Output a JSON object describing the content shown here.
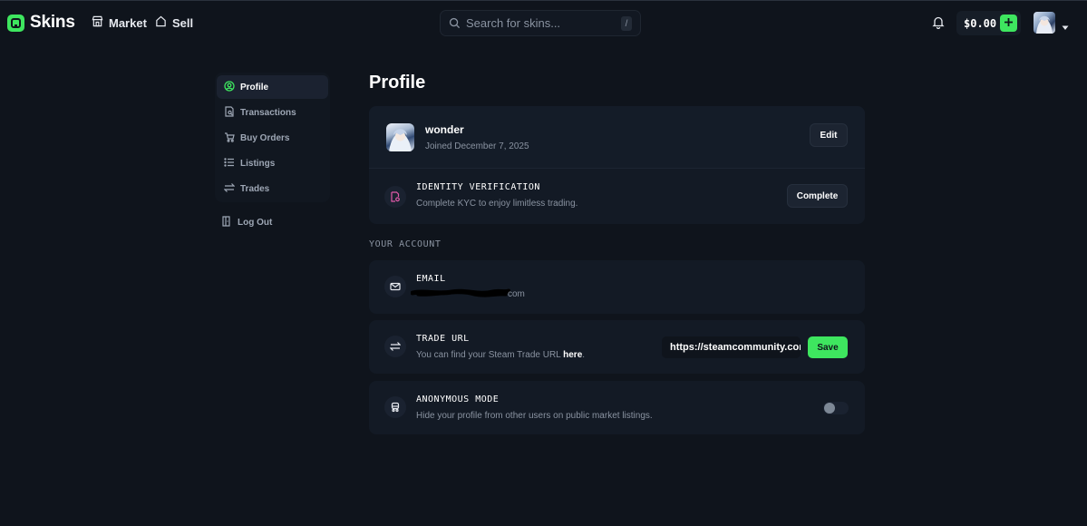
{
  "topbar": {
    "brand": "Skins",
    "nav": [
      {
        "label": "Market",
        "icon": "storefront-icon"
      },
      {
        "label": "Sell",
        "icon": "tag-icon"
      }
    ],
    "search": {
      "placeholder": "Search for skins...",
      "shortcut": "/"
    },
    "balance": "$0.00",
    "colors": {
      "accent": "#3ee65f",
      "background": "#0f141c"
    }
  },
  "sidebar": {
    "items": [
      {
        "label": "Profile",
        "icon": "user-circle-icon",
        "active": true
      },
      {
        "label": "Transactions",
        "icon": "receipt-search-icon",
        "active": false
      },
      {
        "label": "Buy Orders",
        "icon": "cart-icon",
        "active": false
      },
      {
        "label": "Listings",
        "icon": "list-icon",
        "active": false
      },
      {
        "label": "Trades",
        "icon": "arrows-exchange-icon",
        "active": false
      }
    ],
    "logout": {
      "label": "Log Out",
      "icon": "logout-icon"
    }
  },
  "main": {
    "title": "Profile",
    "profile": {
      "username": "wonder",
      "joined": "Joined December 7, 2025",
      "edit_label": "Edit"
    },
    "kyc": {
      "title": "IDENTITY VERIFICATION",
      "description": "Complete KYC to enjoy limitless trading.",
      "button": "Complete"
    },
    "section_label": "YOUR ACCOUNT",
    "email": {
      "title": "EMAIL",
      "value_suffix": "com"
    },
    "trade_url": {
      "title": "TRADE URL",
      "description_prefix": "You can find your Steam Trade URL ",
      "link_text": "here",
      "description_suffix": ".",
      "value": "https://steamcommunity.com",
      "save_label": "Save"
    },
    "anonymous": {
      "title": "ANONYMOUS MODE",
      "description": "Hide your profile from other users on public market listings.",
      "enabled": false
    }
  }
}
